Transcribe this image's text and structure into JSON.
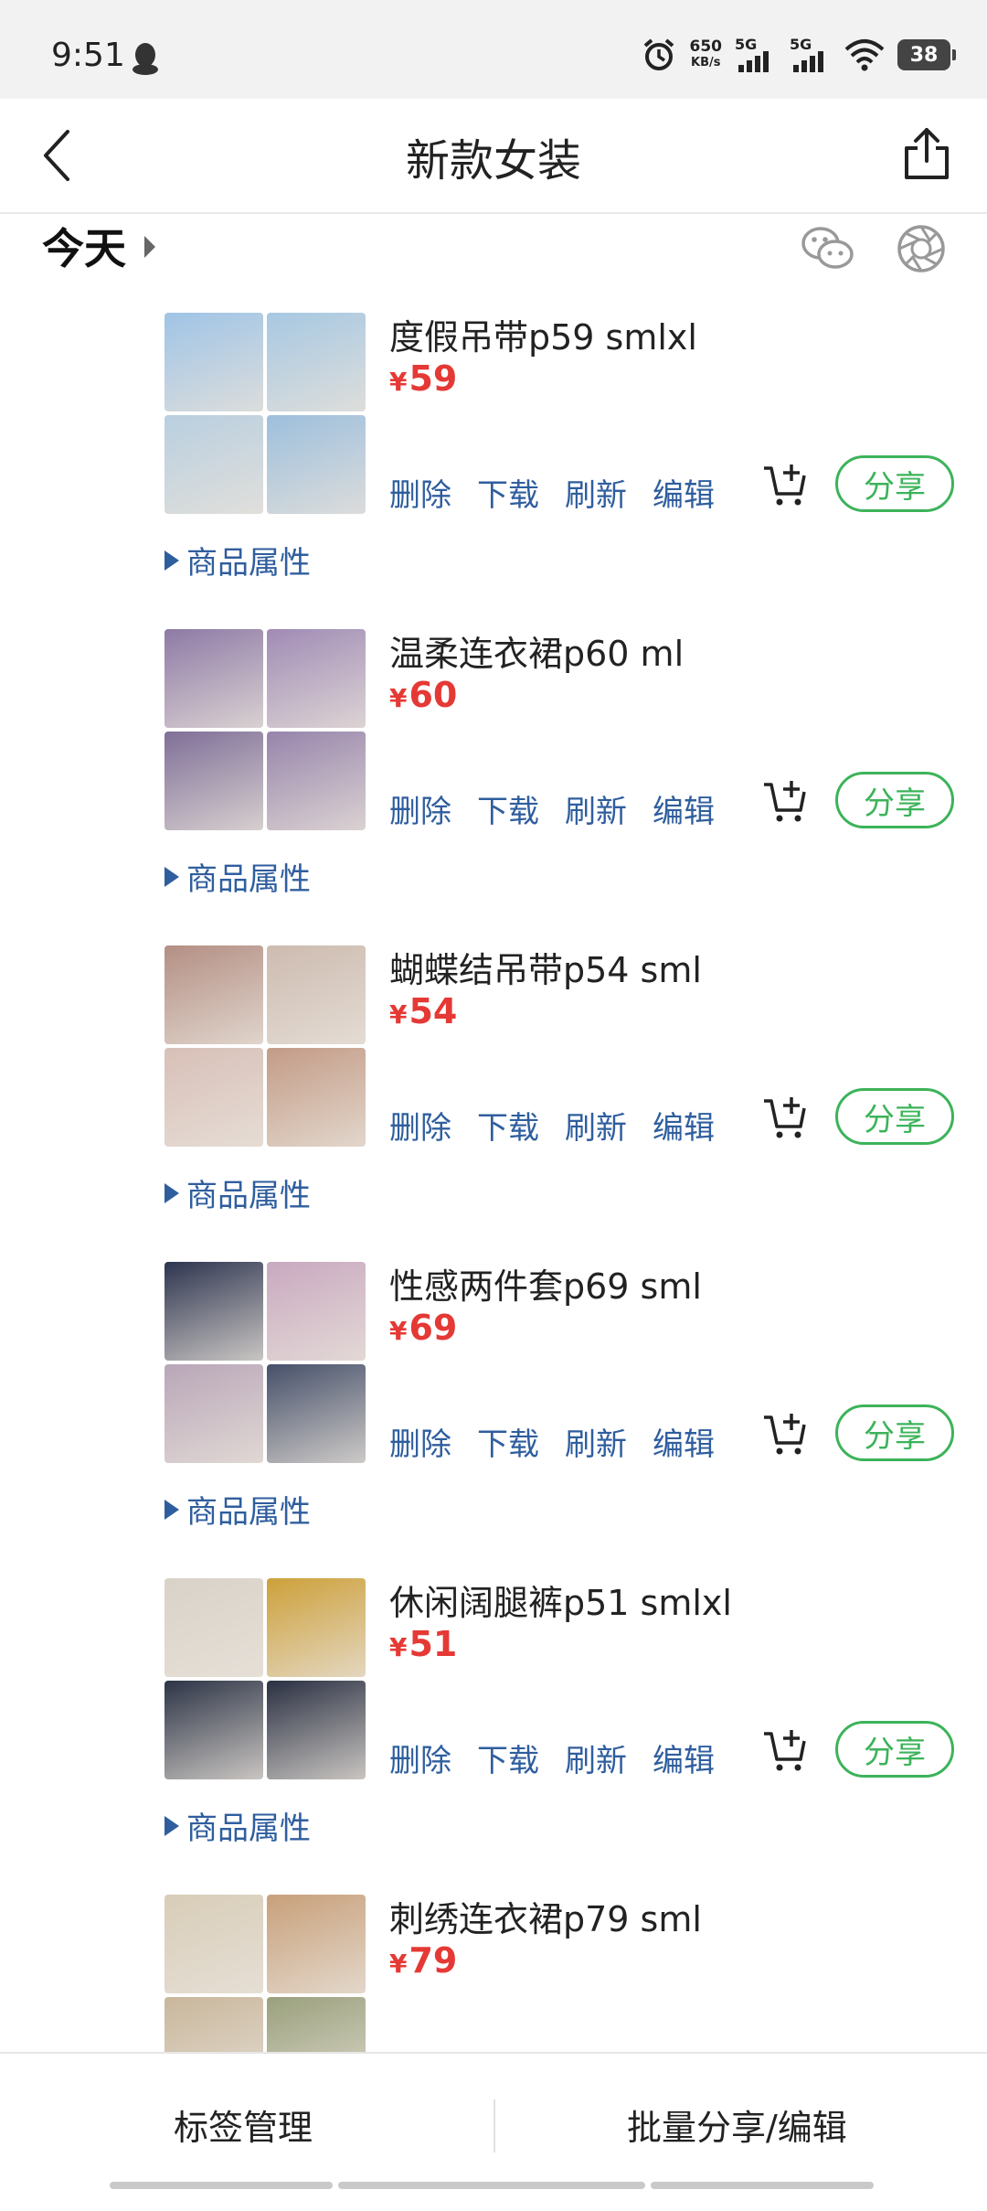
{
  "status": {
    "time": "9:51",
    "speed_top": "650",
    "speed_unit": "KB/s",
    "sim1": "5G",
    "sim2": "5G",
    "battery": "38"
  },
  "header": {
    "title": "新款女装"
  },
  "section": {
    "title": "今天"
  },
  "item_actions": {
    "delete": "删除",
    "download": "下载",
    "refresh": "刷新",
    "edit": "编辑",
    "share": "分享",
    "attributes": "商品属性"
  },
  "products": [
    {
      "name": "度假吊带p59 smlxl",
      "price": "59",
      "colors": [
        "#9fc4e6",
        "#a7c8e2",
        "#b9cfe0",
        "#9dbfdd"
      ]
    },
    {
      "name": "温柔连衣裙p60 ml",
      "price": "60",
      "colors": [
        "#8e7aa6",
        "#a08bb5",
        "#7f6f98",
        "#9784ab"
      ]
    },
    {
      "name": "蝴蝶结吊带p54 sml",
      "price": "54",
      "colors": [
        "#b48f84",
        "#cdbbb0",
        "#d8c0b8",
        "#c39b86"
      ]
    },
    {
      "name": "性感两件套p69 sml",
      "price": "69",
      "colors": [
        "#2e3550",
        "#c9a9c0",
        "#b9a6b8",
        "#46506a"
      ]
    },
    {
      "name": "休闲阔腿裤p51 smlxl",
      "price": "51",
      "colors": [
        "#d9d2c8",
        "#cda03a",
        "#2d3446",
        "#2a3042"
      ]
    },
    {
      "name": "刺绣连衣裙p79 sml",
      "price": "79",
      "colors": [
        "#d8cdb8",
        "#c8a07a",
        "#c9b79c",
        "#9aa07c"
      ]
    }
  ],
  "bottom": {
    "tag_manage": "标签管理",
    "batch_share": "批量分享/编辑"
  }
}
